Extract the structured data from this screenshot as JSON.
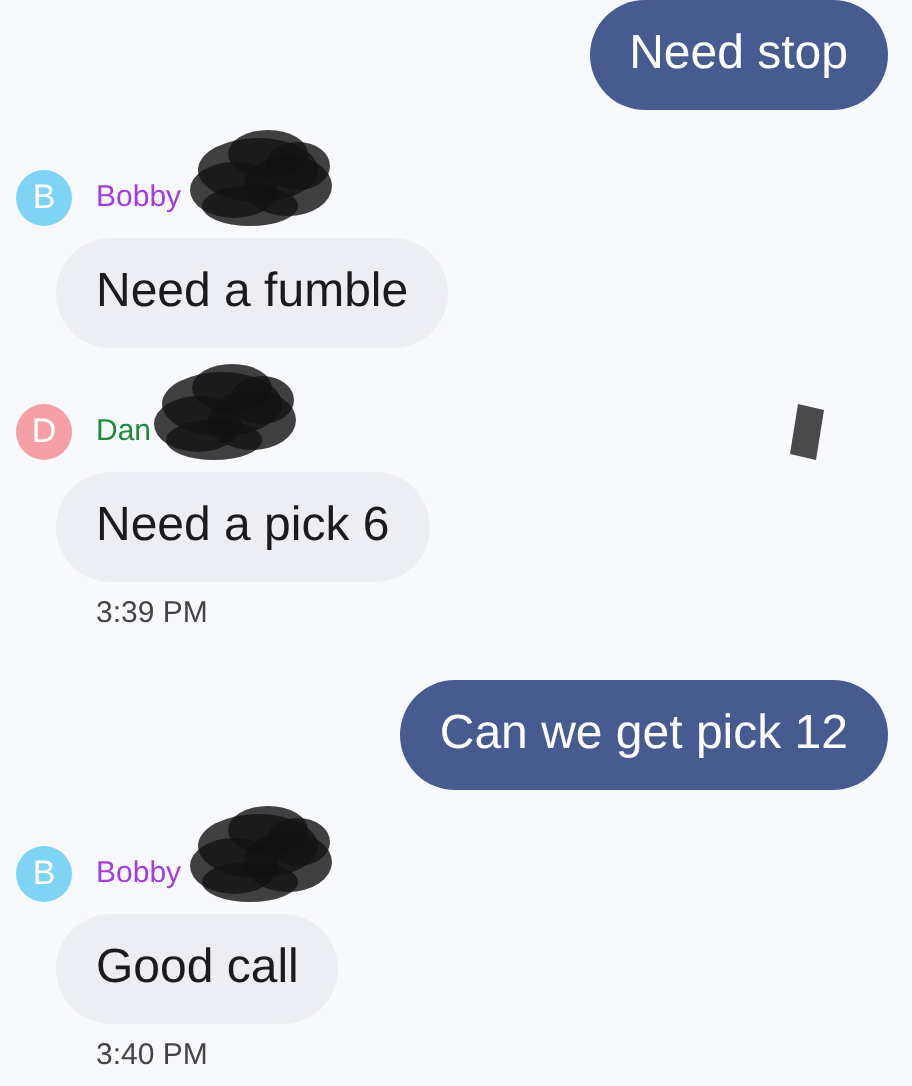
{
  "messages": [
    {
      "kind": "sent",
      "text": "Need stop"
    },
    {
      "kind": "received",
      "avatar": {
        "letter": "B",
        "color": "#7fd3f5"
      },
      "sender": {
        "name": "Bobby",
        "color": "#a23ee0"
      },
      "redacted": true,
      "text": "Need a fumble"
    },
    {
      "kind": "received",
      "avatar": {
        "letter": "D",
        "color": "#f4a0a4"
      },
      "sender": {
        "name": "Dan",
        "color": "#1e8a3a"
      },
      "redacted": true,
      "text": "Need a pick 6",
      "time": "3:39 PM"
    },
    {
      "kind": "sent",
      "text": "Can we get pick 12"
    },
    {
      "kind": "received",
      "avatar": {
        "letter": "B",
        "color": "#7fd3f5"
      },
      "sender": {
        "name": "Bobby",
        "color": "#a23ee0"
      },
      "redacted": true,
      "text": "Good call",
      "time": "3:40 PM"
    }
  ]
}
